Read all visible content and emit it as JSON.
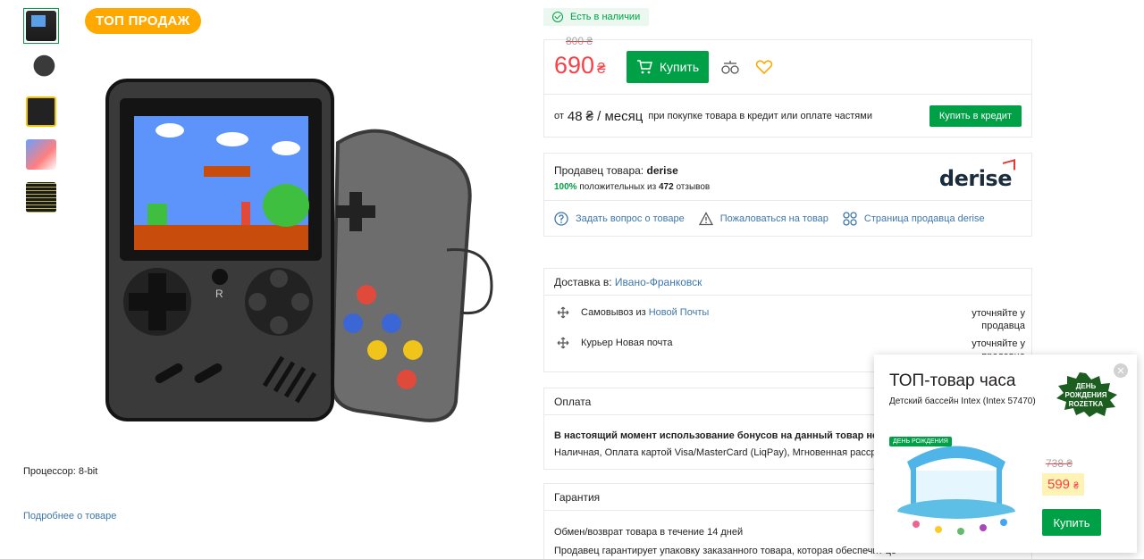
{
  "gallery": {
    "badge": "ТОП ПРОДАЖ",
    "thumbnails": [
      "console-front",
      "console-side",
      "console-box",
      "console-games",
      "games-list"
    ]
  },
  "product": {
    "spec_label": "Процессор: 8-bit",
    "more_link": "Подробнее о товаре"
  },
  "stock": {
    "label": "Есть в наличии"
  },
  "price": {
    "old": "800 ₴",
    "value": "690",
    "currency": "₴",
    "buy_label": "Купить"
  },
  "credit": {
    "from": "от",
    "amount": "48",
    "per": "₴ / месяц",
    "note": "при покупке товара в кредит или оплате частями",
    "button": "Купить в кредит"
  },
  "seller": {
    "label": "Продавец товара:",
    "name": "derise",
    "rating_pct": "100%",
    "rating_mid": "положительных из",
    "reviews": "472",
    "rating_tail": "отзывов",
    "logo": "derise",
    "links": {
      "ask": "Задать вопрос о товаре",
      "complain": "Пожаловаться на товар",
      "page": "Страница продавца derise"
    }
  },
  "delivery": {
    "label": "Доставка в:",
    "city": "Ивано-Франковск",
    "rows": [
      {
        "label": "Самовывоз",
        "mid": "из",
        "link": "Новой Почты",
        "right": "уточняйте у продавца"
      },
      {
        "label": "Курьер Новая почта",
        "right": "уточняйте у продавца"
      }
    ]
  },
  "payment": {
    "title": "Оплата",
    "notice": "В настоящий момент использование бонусов на данный товар недос",
    "methods": "Наличная, Оплата картой Visa/MasterCard (LiqPay), Мгновенная рассрочка"
  },
  "warranty": {
    "title": "Гарантия",
    "line1": "Обмен/возврат товара в течение 14 дней",
    "line2": "Продавец гарантирует упаковку заказанного товара, которая обеспечит це"
  },
  "popup": {
    "title": "ТОП-товар часа",
    "subtitle": "Детский бассейн Intex (Intex 57470)",
    "tag": "ДЕНЬ РОЖДЕНИЯ",
    "old_price": "738 ₴",
    "price": "599",
    "currency": "₴",
    "buy": "Купить",
    "close": "✕",
    "badge_text": [
      "ДЕНЬ",
      "РОЖДЕНИЯ",
      "ROZETKA"
    ]
  },
  "colors": {
    "accent_green": "#00a046",
    "price_red": "#f84147",
    "link_blue": "#3e77aa",
    "badge_orange": "#ffa900"
  }
}
